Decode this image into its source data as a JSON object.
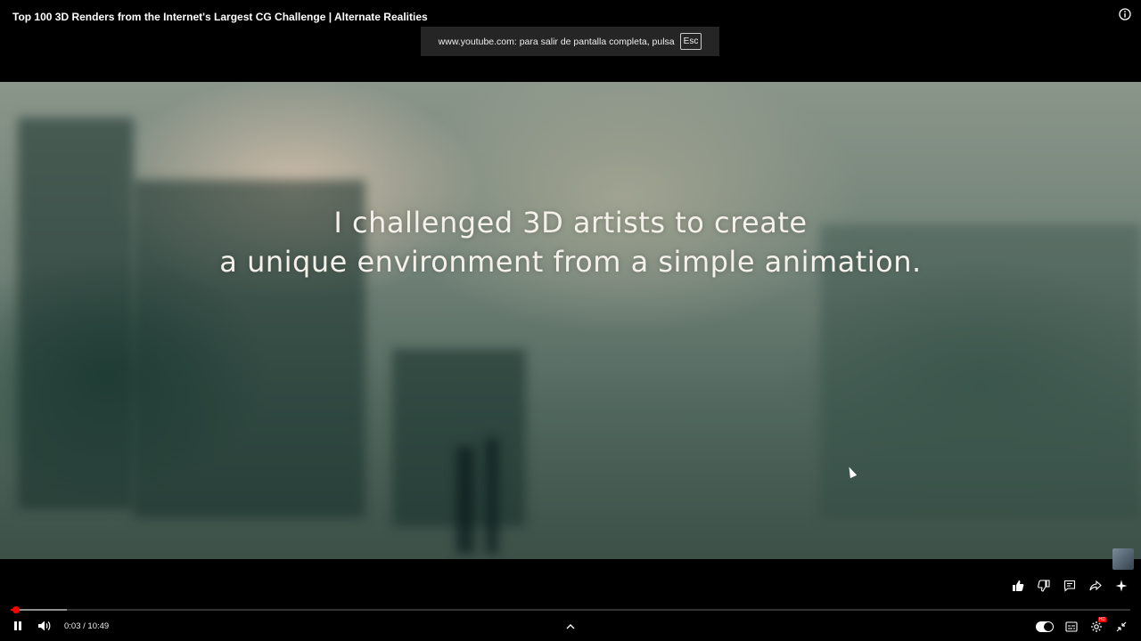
{
  "video": {
    "title": "Top 100 3D Renders from the Internet's Largest CG Challenge | Alternate Realities",
    "caption_line1": "I challenged 3D artists to create",
    "caption_line2": "a unique environment from a simple animation."
  },
  "fullscreen_banner": {
    "text": "www.youtube.com: para salir de pantalla completa, pulsa",
    "key": "Esc"
  },
  "player": {
    "current_time": "0:03",
    "duration": "10:49",
    "time_display": "0:03 / 10:49",
    "played_fraction": 0.005,
    "buffered_fraction": 0.05,
    "autoplay_on": true,
    "quality_badge": "HD"
  },
  "icons": {
    "info": "info-icon",
    "like": "thumbs-up-icon",
    "dislike": "thumbs-down-icon",
    "comments": "comment-icon",
    "share": "share-icon",
    "ask": "sparkle-icon",
    "pause": "pause-icon",
    "volume": "volume-icon",
    "chapters": "chevron-up-icon",
    "autoplay": "autoplay-toggle",
    "subtitles": "subtitles-icon",
    "settings": "gear-icon",
    "exit_fullscreen": "exit-fullscreen-icon"
  },
  "colors": {
    "accent": "#ff0000",
    "background": "#000000"
  }
}
